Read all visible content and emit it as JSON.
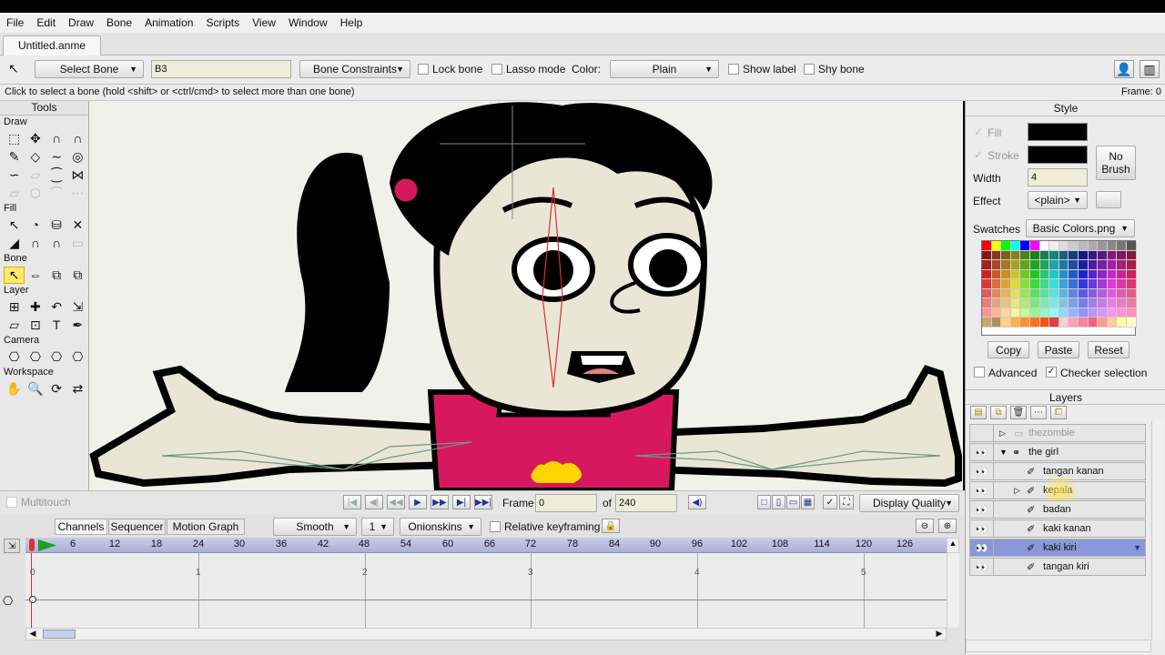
{
  "menu": [
    "File",
    "Edit",
    "Draw",
    "Bone",
    "Animation",
    "Scripts",
    "View",
    "Window",
    "Help"
  ],
  "document_tab": "Untitled.anme",
  "toolbar": {
    "tool_mode": "Select Bone",
    "bone_name": "B3",
    "bone_constraints": "Bone Constraints",
    "lock_bone": "Lock bone",
    "lasso_mode": "Lasso mode",
    "color_label": "Color:",
    "color_value": "Plain",
    "show_label": "Show label",
    "shy_bone": "Shy bone"
  },
  "status": {
    "hint": "Click to select a bone (hold <shift> or <ctrl/cmd> to select more than one bone)",
    "frame": "Frame: 0"
  },
  "tools": {
    "title": "Tools",
    "sections": [
      "Draw",
      "Fill",
      "Bone",
      "Layer",
      "Camera",
      "Workspace"
    ]
  },
  "canvas_bar": {
    "multitouch": "Multitouch",
    "frame_label": "Frame",
    "frame_value": "0",
    "of_label": "of",
    "total_frames": "240",
    "display_quality": "Display Quality"
  },
  "timeline": {
    "tabs": [
      "Channels",
      "Sequencer",
      "Motion Graph"
    ],
    "interpolation": "Smooth",
    "step": "1",
    "onionskins": "Onionskins",
    "relative_keyframing": "Relative keyframing",
    "ruler": [
      "6",
      "12",
      "18",
      "24",
      "30",
      "36",
      "42",
      "48",
      "54",
      "60",
      "66",
      "72",
      "78",
      "84",
      "90",
      "96",
      "102",
      "108",
      "114",
      "120",
      "126"
    ],
    "seconds": [
      "0",
      "1",
      "2",
      "3",
      "4",
      "5"
    ]
  },
  "style": {
    "title": "Style",
    "fill_label": "Fill",
    "stroke_label": "Stroke",
    "fill_color": "#000000",
    "stroke_color": "#000000",
    "no_brush": "No Brush",
    "width_label": "Width",
    "width_value": "4",
    "effect_label": "Effect",
    "effect_value": "<plain>",
    "swatches_label": "Swatches",
    "swatches_value": "Basic Colors.png",
    "copy": "Copy",
    "paste": "Paste",
    "reset": "Reset",
    "advanced": "Advanced",
    "checker_selection": "Checker selection"
  },
  "layers": {
    "title": "Layers",
    "items": [
      {
        "name": "thezombie",
        "indent": 0,
        "selected": false
      },
      {
        "name": "the girl",
        "indent": 0,
        "selected": false
      },
      {
        "name": "tangan kanan",
        "indent": 1,
        "selected": false
      },
      {
        "name": "kepala",
        "indent": 1,
        "selected": false
      },
      {
        "name": "badan",
        "indent": 1,
        "selected": false
      },
      {
        "name": "kaki kanan",
        "indent": 1,
        "selected": false
      },
      {
        "name": "kaki kiri",
        "indent": 1,
        "selected": true
      },
      {
        "name": "tangan kiri",
        "indent": 1,
        "selected": false
      }
    ]
  },
  "colors": {
    "ruler": "#aab0d8",
    "selected_layer": "#8a98d8",
    "tool_highlight": "#ffe86a",
    "canvas_bg": "#f0f1ea",
    "playhead": "#e03030"
  }
}
